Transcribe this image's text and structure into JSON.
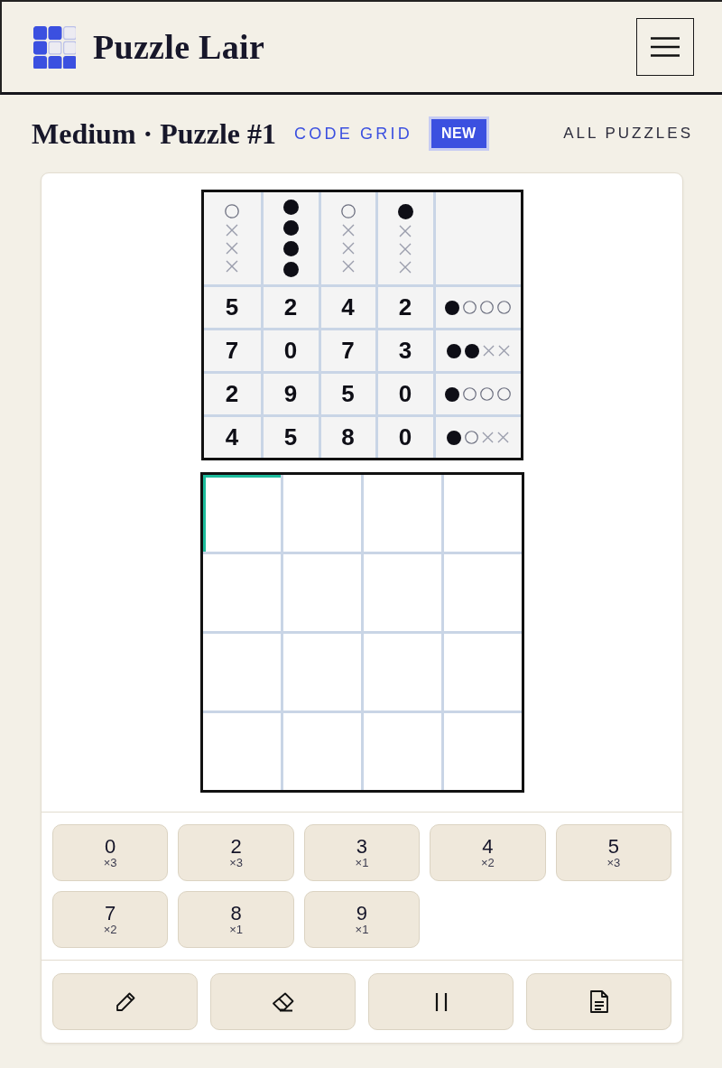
{
  "header": {
    "title": "Puzzle Lair"
  },
  "title_bar": {
    "heading": "Medium · Puzzle #1",
    "puzzle_type": "CODE GRID",
    "badge": "NEW",
    "link": "ALL PUZZLES"
  },
  "clue_grid": {
    "column_marks": [
      [
        {
          "kind": "hollow"
        },
        {
          "kind": "cross"
        },
        {
          "kind": "cross"
        },
        {
          "kind": "cross"
        }
      ],
      [
        {
          "kind": "filled"
        },
        {
          "kind": "filled"
        },
        {
          "kind": "filled"
        },
        {
          "kind": "filled"
        }
      ],
      [
        {
          "kind": "hollow"
        },
        {
          "kind": "cross"
        },
        {
          "kind": "cross"
        },
        {
          "kind": "cross"
        }
      ],
      [
        {
          "kind": "filled"
        },
        {
          "kind": "cross"
        },
        {
          "kind": "cross"
        },
        {
          "kind": "cross"
        }
      ]
    ],
    "rows": [
      {
        "digits": [
          "5",
          "2",
          "4",
          "2"
        ],
        "feedback": [
          {
            "kind": "filled"
          },
          {
            "kind": "hollow"
          },
          {
            "kind": "hollow"
          },
          {
            "kind": "hollow"
          }
        ]
      },
      {
        "digits": [
          "7",
          "0",
          "7",
          "3"
        ],
        "feedback": [
          {
            "kind": "filled"
          },
          {
            "kind": "filled"
          },
          {
            "kind": "cross"
          },
          {
            "kind": "cross"
          }
        ]
      },
      {
        "digits": [
          "2",
          "9",
          "5",
          "0"
        ],
        "feedback": [
          {
            "kind": "filled"
          },
          {
            "kind": "hollow"
          },
          {
            "kind": "hollow"
          },
          {
            "kind": "hollow"
          }
        ]
      },
      {
        "digits": [
          "4",
          "5",
          "8",
          "0"
        ],
        "feedback": [
          {
            "kind": "filled"
          },
          {
            "kind": "hollow"
          },
          {
            "kind": "cross"
          },
          {
            "kind": "cross"
          }
        ]
      }
    ]
  },
  "answer_grid": {
    "rows": [
      [
        {
          "selected": true
        },
        {
          "selected": false
        },
        {
          "selected": false
        },
        {
          "selected": false
        }
      ],
      [
        {
          "selected": false
        },
        {
          "selected": false
        },
        {
          "selected": false
        },
        {
          "selected": false
        }
      ],
      [
        {
          "selected": false
        },
        {
          "selected": false
        },
        {
          "selected": false
        },
        {
          "selected": false
        }
      ],
      [
        {
          "selected": false
        },
        {
          "selected": false
        },
        {
          "selected": false
        },
        {
          "selected": false
        }
      ]
    ]
  },
  "number_pad": [
    {
      "digit": "0",
      "count": "×3"
    },
    {
      "digit": "2",
      "count": "×3"
    },
    {
      "digit": "3",
      "count": "×1"
    },
    {
      "digit": "4",
      "count": "×2"
    },
    {
      "digit": "5",
      "count": "×3"
    },
    {
      "digit": "7",
      "count": "×2"
    },
    {
      "digit": "8",
      "count": "×1"
    },
    {
      "digit": "9",
      "count": "×1"
    }
  ],
  "tools": [
    {
      "kind": "pencil"
    },
    {
      "kind": "eraser"
    },
    {
      "kind": "pause"
    },
    {
      "kind": "notes"
    }
  ]
}
